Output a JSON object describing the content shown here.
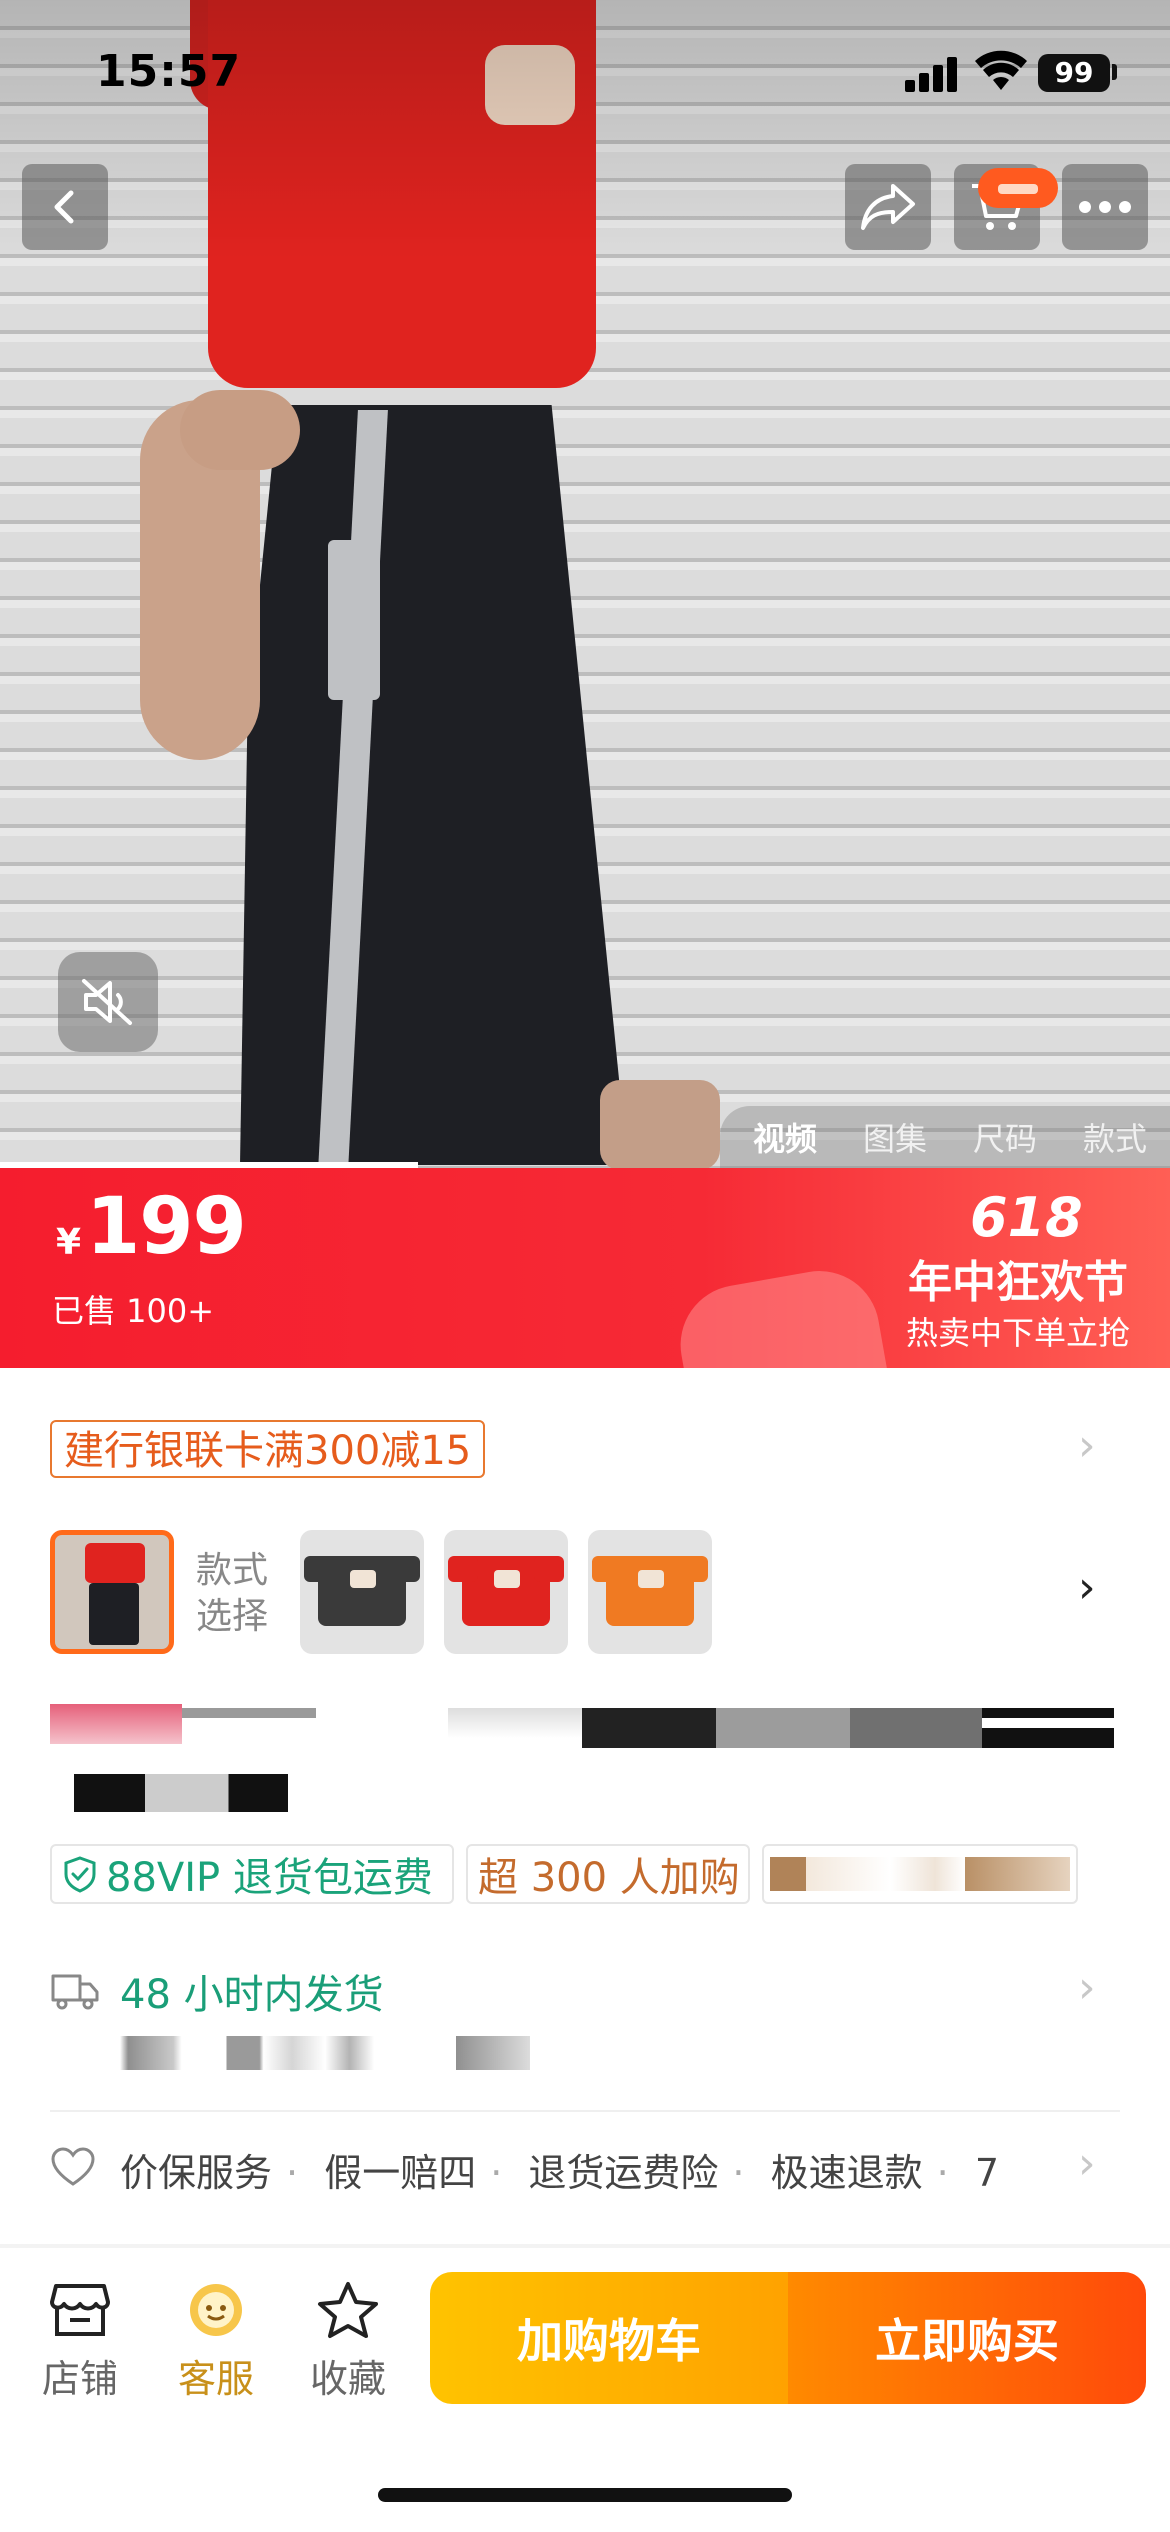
{
  "status_bar": {
    "time": "15:57",
    "battery": "99"
  },
  "nav": {
    "back_icon": "chevron-left-icon",
    "share_icon": "share-icon",
    "cart_icon": "cart-icon",
    "more_icon": "more-icon"
  },
  "media": {
    "tabs": [
      {
        "label": "视频",
        "active": true
      },
      {
        "label": "图集",
        "active": false
      },
      {
        "label": "尺码",
        "active": false
      },
      {
        "label": "款式",
        "active": false
      }
    ],
    "mute_icon": "muted-speaker-icon"
  },
  "price": {
    "currency": "¥",
    "value": "199",
    "sold": "已售 100+"
  },
  "promo": {
    "badge": "618",
    "title": "年中狂欢节",
    "subtitle": "热卖中下单立抢"
  },
  "coupon": {
    "text": "建行银联卡满300减15"
  },
  "style_selector": {
    "label_line1": "款式",
    "label_line2": "选择",
    "options": [
      {
        "color": "#3a3a3a"
      },
      {
        "color": "#e0231f"
      },
      {
        "color": "#f07a22"
      }
    ]
  },
  "tags": {
    "vip": "88VIP 退货包运费",
    "add_to_cart": "超 300 人加购"
  },
  "delivery": {
    "text": "48 小时内发货"
  },
  "services": {
    "items": [
      "价保服务",
      "假一赔四",
      "退货运费险",
      "极速退款",
      "7"
    ]
  },
  "bottom_bar": {
    "store": "店铺",
    "customer_service": "客服",
    "favorite": "收藏",
    "add_cart": "加购物车",
    "buy_now": "立即购买"
  },
  "colors": {
    "accent_red": "#f51d2e",
    "accent_orange": "#ff6a1a",
    "green": "#1aa37a",
    "gold": "#c8901a"
  }
}
